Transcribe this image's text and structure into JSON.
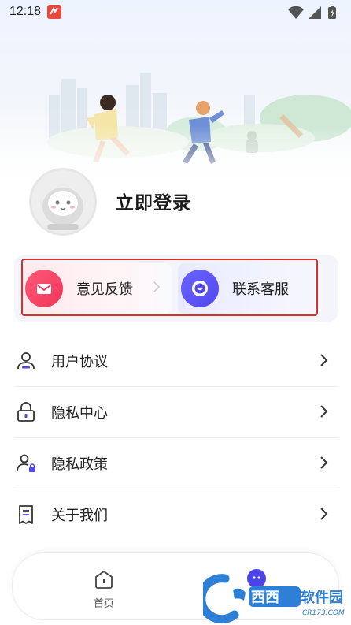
{
  "status_bar": {
    "time": "12:18"
  },
  "profile": {
    "login_label": "立即登录"
  },
  "quick_actions": [
    {
      "label": "意见反馈",
      "icon": "mail-icon"
    },
    {
      "label": "联系客服",
      "icon": "chat-icon"
    }
  ],
  "menu": [
    {
      "label": "用户协议",
      "icon": "user-icon"
    },
    {
      "label": "隐私中心",
      "icon": "lock-icon"
    },
    {
      "label": "隐私政策",
      "icon": "user-lock-icon"
    },
    {
      "label": "关于我们",
      "icon": "document-icon"
    }
  ],
  "bottom_nav": {
    "home_label": "首页"
  },
  "watermark": {
    "brand": "西西软件园",
    "domain": "CR173.COM"
  },
  "colors": {
    "feedback_accent": "#f0345a",
    "service_accent": "#5147f0",
    "highlight": "#d9312a"
  }
}
